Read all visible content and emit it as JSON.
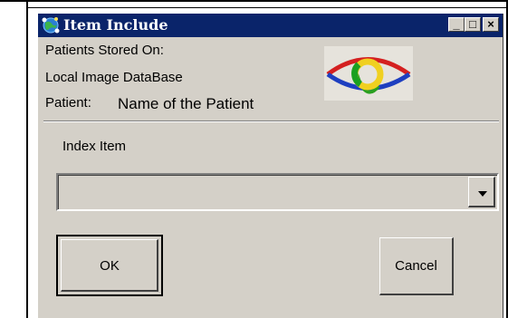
{
  "window": {
    "title": "Item Include",
    "controls": {
      "minimize": "_",
      "maximize": "□",
      "close": "×"
    }
  },
  "storage": {
    "stored_on_label": "Patients Stored On:",
    "database_name": "Local Image DataBase"
  },
  "patient": {
    "label": "Patient:",
    "name": "Name of the Patient"
  },
  "index_item": {
    "label": "Index Item",
    "selected_value": ""
  },
  "buttons": {
    "ok": "OK",
    "cancel": "Cancel"
  },
  "icons": {
    "title_icon": "globe-network-icon",
    "logo": "eye-logo-icon",
    "dropdown": "chevron-down-icon"
  }
}
